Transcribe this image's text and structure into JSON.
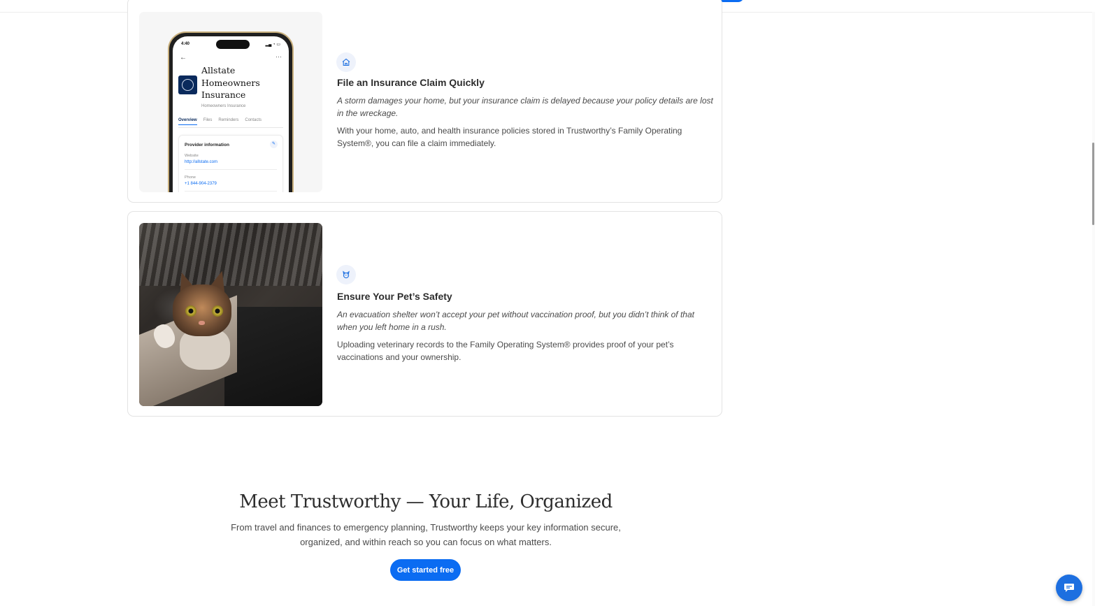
{
  "cards": [
    {
      "icon": "house-icon",
      "title": "File an Insurance Claim Quickly",
      "italic": "A storm damages your home, but your insurance claim is delayed because your policy details are lost in the wreckage.",
      "body": "With your home, auto, and health insurance policies stored in Trustworthy’s Family Operating System®, you can file a claim immediately.",
      "phone": {
        "time": "4:40",
        "provider_name": "Allstate Homeowners Insurance",
        "provider_sub": "Homeowners Insurance",
        "tabs": [
          "Overview",
          "Files",
          "Reminders",
          "Contacts"
        ],
        "info_title": "Provider information",
        "website_label": "Website",
        "website_value": "http://allstate.com",
        "phone_label": "Phone",
        "phone_value": "+1 844-904-2379"
      }
    },
    {
      "icon": "paw-icon",
      "title": "Ensure Your Pet’s Safety",
      "italic": "An evacuation shelter won’t accept your pet without vaccination proof, but you didn’t think of that when you left home in a rush.",
      "body": "Uploading veterinary records to the Family Operating System® provides proof of your pet’s vaccinations and your ownership."
    }
  ],
  "section": {
    "title": "Meet Trustworthy — Your Life, Organized",
    "subtitle": "From travel and finances to emergency planning, Trustworthy keeps your key information secure, organized, and within reach so you can focus on what matters.",
    "cta": "Get started free"
  },
  "chat": {
    "icon": "chat-icon"
  },
  "colors": {
    "accent": "#0b6cf2",
    "icon_bg": "#eef2fb"
  }
}
